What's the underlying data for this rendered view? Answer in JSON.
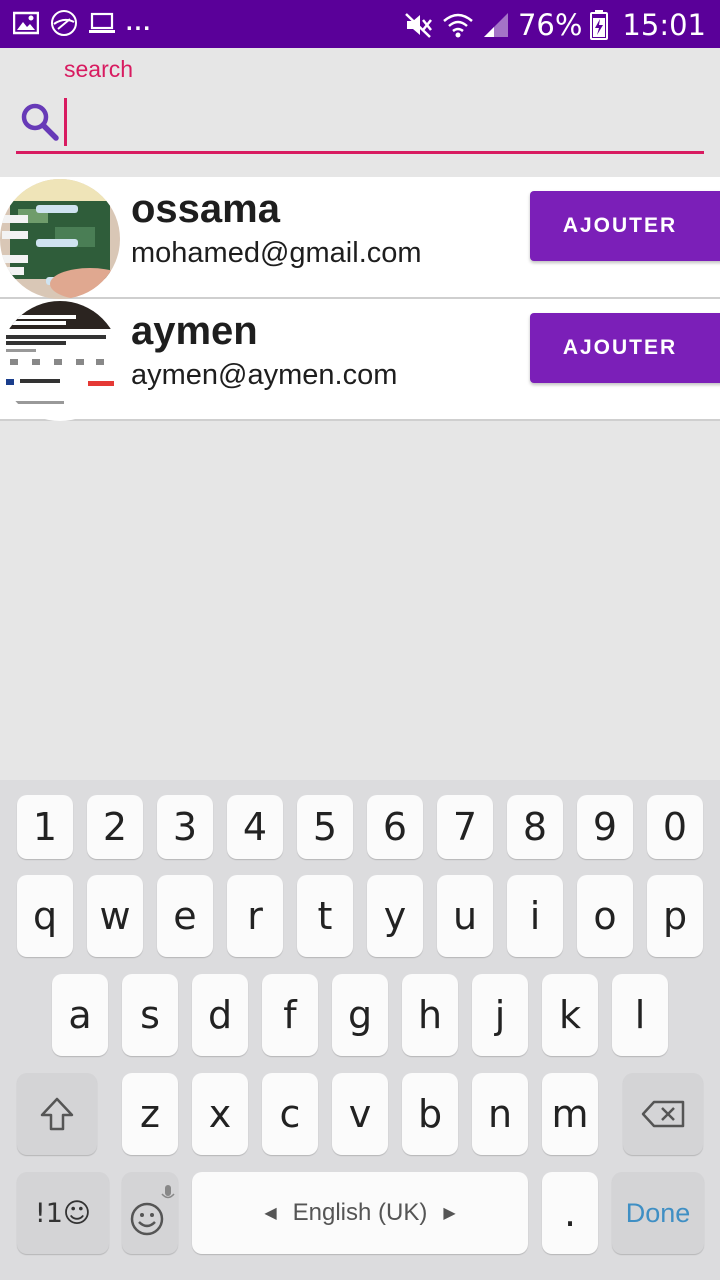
{
  "status_bar": {
    "battery_percent": "76%",
    "time": "15:01",
    "overflow": "...",
    "icons": [
      "image-icon",
      "app-icon",
      "laptop-icon",
      "mute-icon",
      "wifi-icon",
      "signal-icon",
      "battery-charging-icon"
    ]
  },
  "search": {
    "label": "search",
    "value": "",
    "placeholder": ""
  },
  "users": [
    {
      "name": "ossama",
      "email": "mohamed@gmail.com",
      "button": "AJOUTER"
    },
    {
      "name": "aymen",
      "email": "aymen@aymen.com",
      "button": "AJOUTER"
    }
  ],
  "keyboard": {
    "digits": [
      "1",
      "2",
      "3",
      "4",
      "5",
      "6",
      "7",
      "8",
      "9",
      "0"
    ],
    "row1": [
      "q",
      "w",
      "e",
      "r",
      "t",
      "y",
      "u",
      "i",
      "o",
      "p"
    ],
    "row2": [
      "a",
      "s",
      "d",
      "f",
      "g",
      "h",
      "j",
      "k",
      "l"
    ],
    "row3": [
      "z",
      "x",
      "c",
      "v",
      "b",
      "n",
      "m"
    ],
    "symbols_label": "!1☺",
    "space_label": "English (UK)",
    "period": ".",
    "done_label": "Done"
  },
  "colors": {
    "status_bar": "#5a0099",
    "accent": "#d81b60",
    "button": "#7b1fb8",
    "search_icon": "#673ab7"
  }
}
